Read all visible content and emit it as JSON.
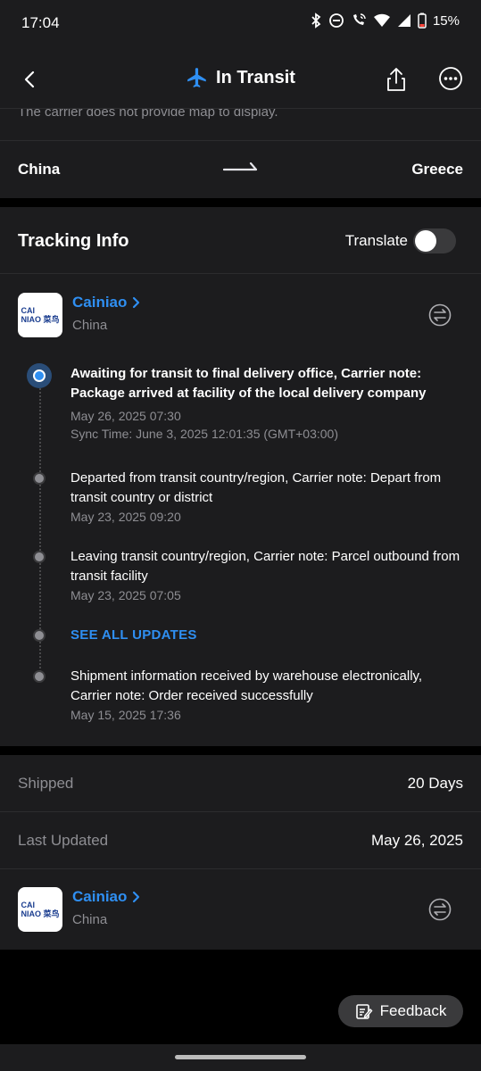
{
  "status_bar": {
    "time": "17:04",
    "battery": "15%"
  },
  "header": {
    "title": "In Transit"
  },
  "route": {
    "map_note": "The carrier does not provide map to display.",
    "origin": "China",
    "destination": "Greece"
  },
  "tracking": {
    "title": "Tracking Info",
    "translate_label": "Translate",
    "translate_on": false,
    "carrier": {
      "name": "Cainiao",
      "country": "China",
      "logo_text_1": "CAI",
      "logo_text_2": "NIAO 菜鸟"
    },
    "events": [
      {
        "description": "Awaiting for transit to final delivery office, Carrier note: Package arrived at facility of the local delivery company",
        "time": "May 26, 2025 07:30",
        "sync": "Sync Time: June 3, 2025 12:01:35 (GMT+03:00)"
      },
      {
        "description": "Departed from transit country/region, Carrier note: Depart from transit country or district",
        "time": "May 23, 2025 09:20"
      },
      {
        "description": "Leaving transit country/region, Carrier note: Parcel outbound from transit facility",
        "time": "May 23, 2025 07:05"
      },
      {
        "description": "Shipment information received by warehouse electronically, Carrier note: Order received successfully",
        "time": "May 15, 2025 17:36"
      }
    ],
    "see_all_label": "SEE ALL UPDATES"
  },
  "summary": {
    "shipped_label": "Shipped",
    "shipped_value": "20 Days",
    "updated_label": "Last Updated",
    "updated_value": "May 26, 2025",
    "carrier": {
      "name": "Cainiao",
      "country": "China"
    }
  },
  "feedback": {
    "label": "Feedback"
  },
  "colors": {
    "accent": "#2f8ff2",
    "background": "#1c1c1e",
    "secondary_text": "#8e8e93"
  }
}
